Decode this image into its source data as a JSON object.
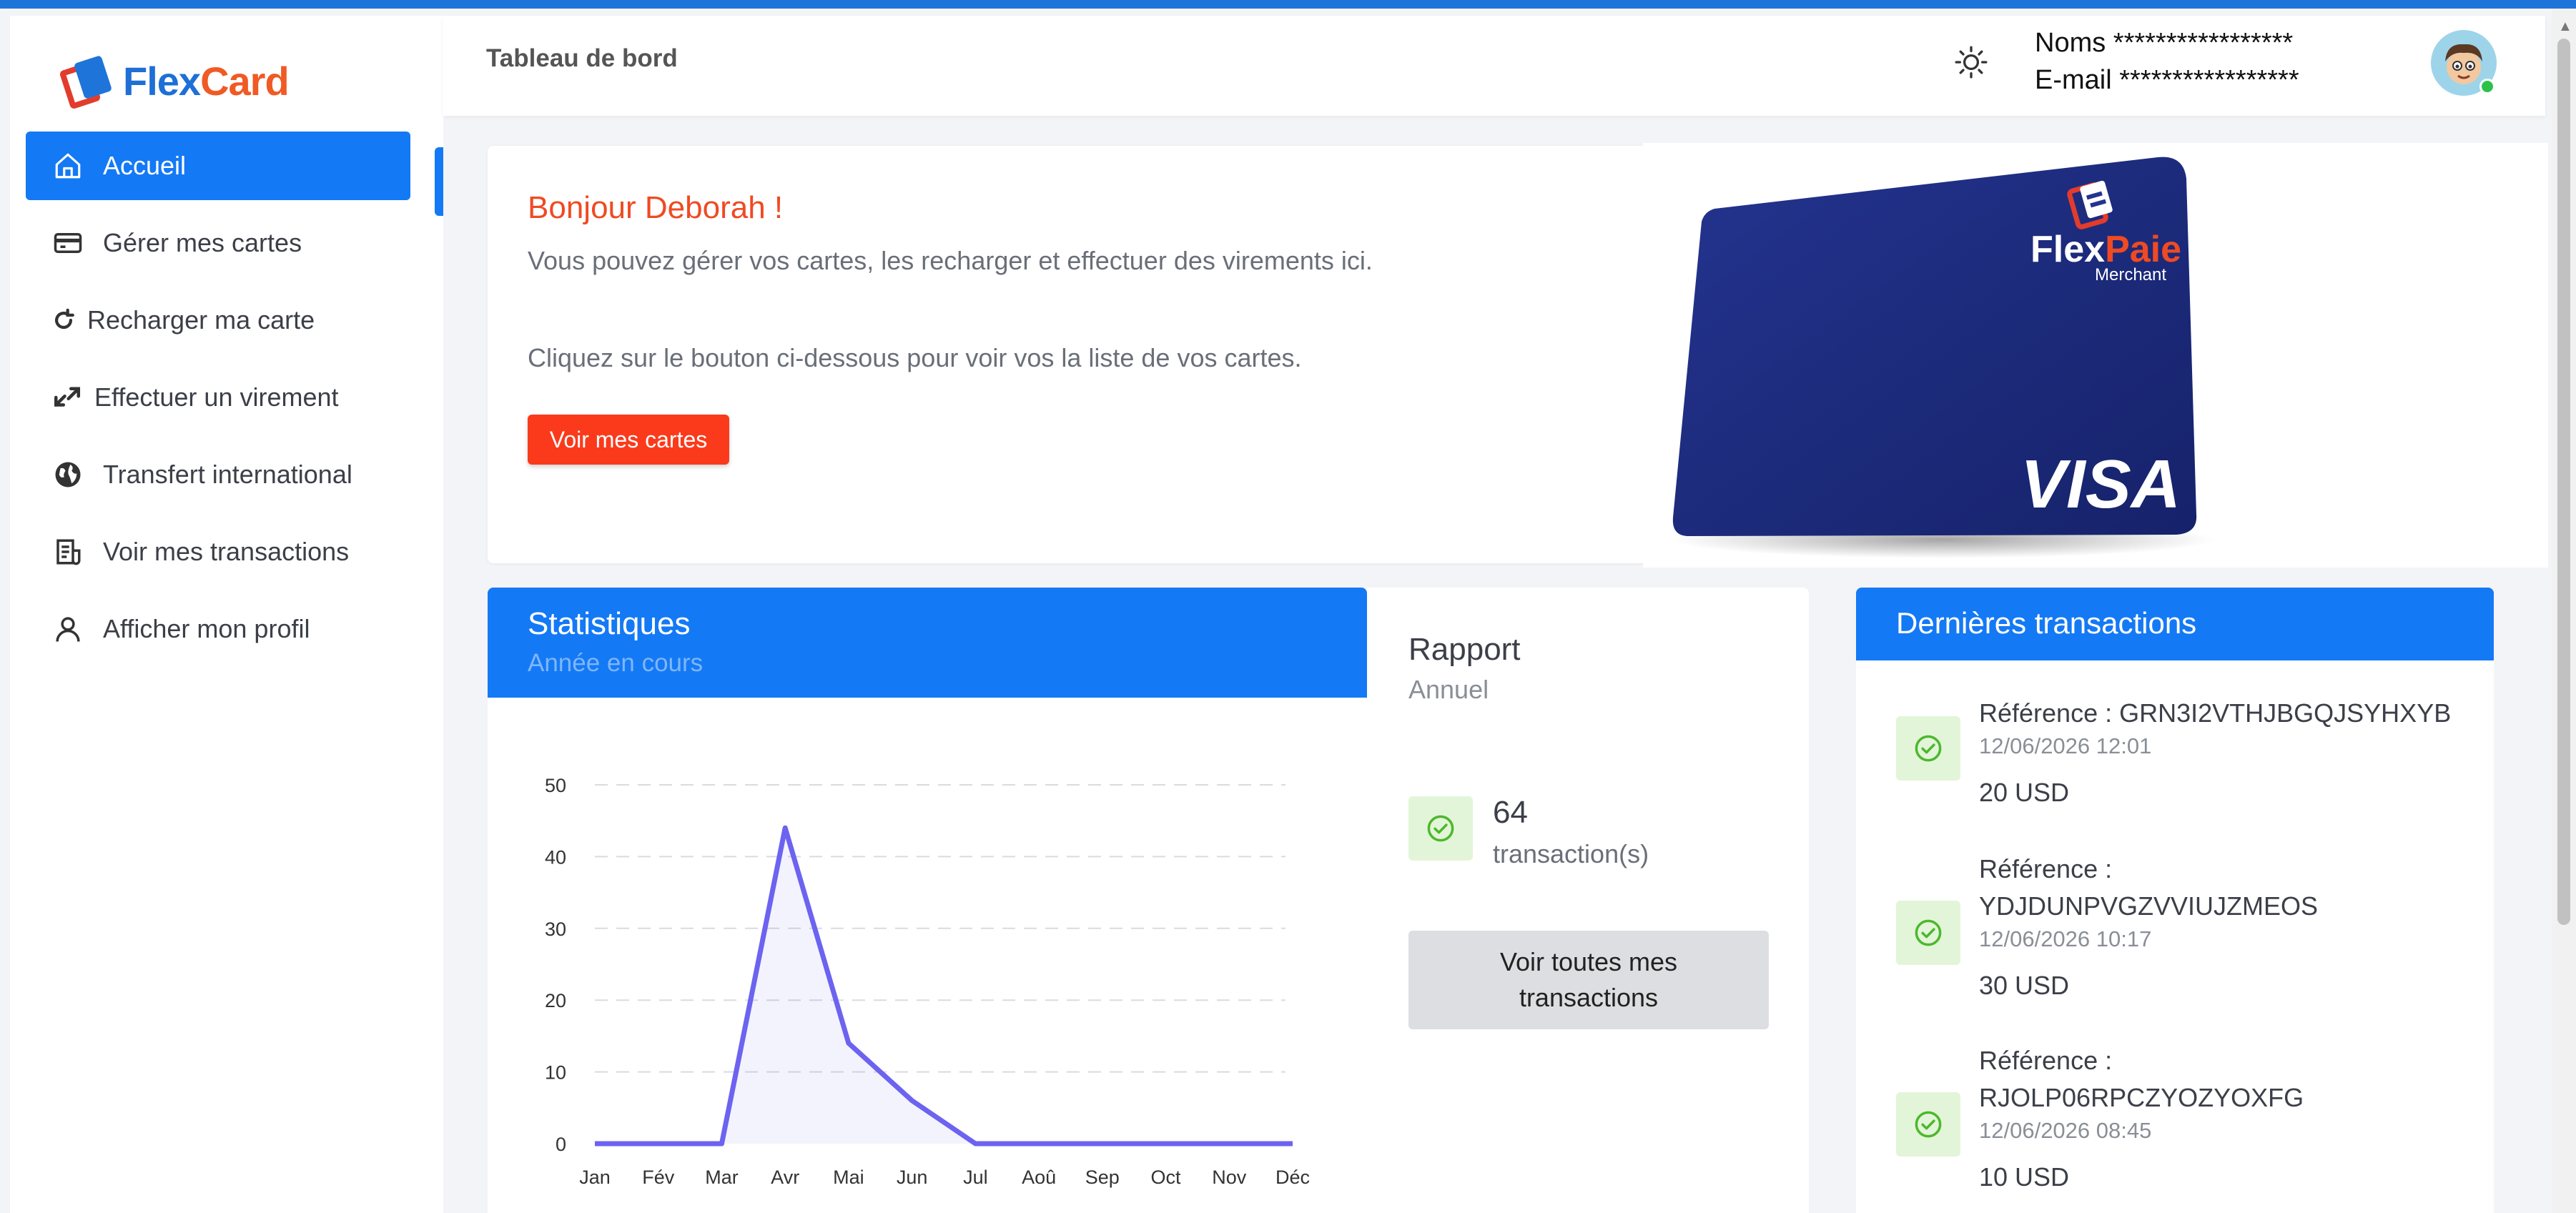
{
  "app": {
    "logo_part1": "Flex",
    "logo_part2": "Card"
  },
  "sidebar": {
    "items": [
      {
        "label": "Accueil",
        "icon": "home-icon"
      },
      {
        "label": "Gérer mes cartes",
        "icon": "credit-card-icon"
      },
      {
        "label": "Recharger ma carte",
        "icon": "refresh-icon"
      },
      {
        "label": "Effectuer un virement",
        "icon": "transfer-arrows-icon"
      },
      {
        "label": "Transfert international",
        "icon": "globe-icon"
      },
      {
        "label": "Voir mes transactions",
        "icon": "receipt-icon"
      },
      {
        "label": "Afficher mon profil",
        "icon": "user-icon"
      }
    ]
  },
  "header": {
    "breadcrumb": "Tableau de bord",
    "name_line": "Noms *****************",
    "email_line": "E-mail *****************"
  },
  "welcome": {
    "greeting": "Bonjour Deborah !",
    "line1": "Vous pouvez gérer vos cartes, les recharger et effectuer des virements ici.",
    "line2": "Cliquez sur le bouton ci-dessous pour voir vos la liste de vos cartes.",
    "button": "Voir mes cartes",
    "card": {
      "brand1": "Flex",
      "brand2": "Paie",
      "tier": "Merchant",
      "network": "VISA"
    }
  },
  "stats": {
    "title": "Statistiques",
    "subtitle": "Année en cours"
  },
  "chart_data": {
    "type": "area",
    "categories": [
      "Jan",
      "Fév",
      "Mar",
      "Avr",
      "Mai",
      "Jun",
      "Jul",
      "Aoû",
      "Sep",
      "Oct",
      "Nov",
      "Déc"
    ],
    "values": [
      0,
      0,
      0,
      44,
      14,
      6,
      0,
      0,
      0,
      0,
      0,
      0
    ],
    "ylim": [
      0,
      50
    ],
    "yticks": [
      0,
      10,
      20,
      30,
      40,
      50
    ],
    "grid": true,
    "color": "#6c63f0"
  },
  "rapport": {
    "title": "Rapport",
    "subtitle": "Annuel",
    "count": "64",
    "unit": "transaction(s)",
    "button_line1": "Voir toutes mes",
    "button_line2": "transactions"
  },
  "transactions": {
    "title": "Dernières transactions",
    "items": [
      {
        "ref": "Référence : GRN3I2VTHJBGQJSYHXYB",
        "date": "12/06/2026 12:01",
        "amount": "20 USD"
      },
      {
        "ref": "Référence : YDJDUNPVGZVVIUJZMEOS",
        "date": "12/06/2026 10:17",
        "amount": "30 USD"
      },
      {
        "ref": "Référence : RJOLP06RPCZYOZYOXFG",
        "date": "12/06/2026 08:45",
        "amount": "10 USD"
      }
    ]
  }
}
